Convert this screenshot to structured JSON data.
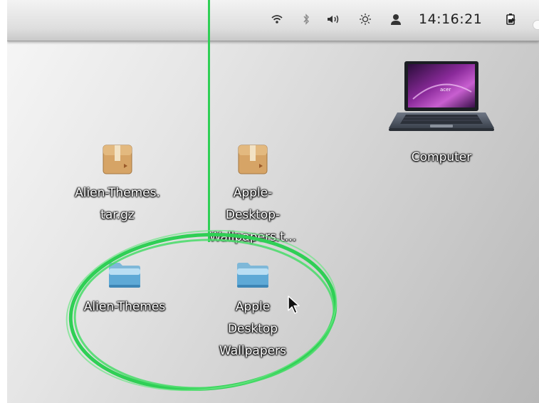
{
  "panel": {
    "clock": "14:16:21",
    "tray_icons": [
      "wifi-icon",
      "bluetooth-icon",
      "volume-icon",
      "brightness-icon",
      "user-icon",
      "battery-icon"
    ]
  },
  "desktop": {
    "items": [
      {
        "name": "Computer",
        "lines": [
          "Computer"
        ],
        "icon": "laptop-icon"
      },
      {
        "name": "Alien-Themes.tar.gz",
        "lines": [
          "Alien-Themes.",
          "tar.gz"
        ],
        "icon": "package-icon"
      },
      {
        "name": "Apple-Desktop-Wallpapers.t...",
        "lines": [
          "Apple-",
          "Desktop-",
          "Wallpapers.t..."
        ],
        "icon": "package-icon"
      },
      {
        "name": "Alien-Themes",
        "lines": [
          "Alien-Themes"
        ],
        "icon": "folder-icon"
      },
      {
        "name": "Apple Desktop Wallpapers",
        "lines": [
          "Apple",
          "Desktop",
          "Wallpapers"
        ],
        "icon": "folder-icon"
      }
    ]
  },
  "colors": {
    "annotation_green": "#2fcf55",
    "folder_blue": "#5fb4e6",
    "package_tan": "#d9a86c"
  }
}
